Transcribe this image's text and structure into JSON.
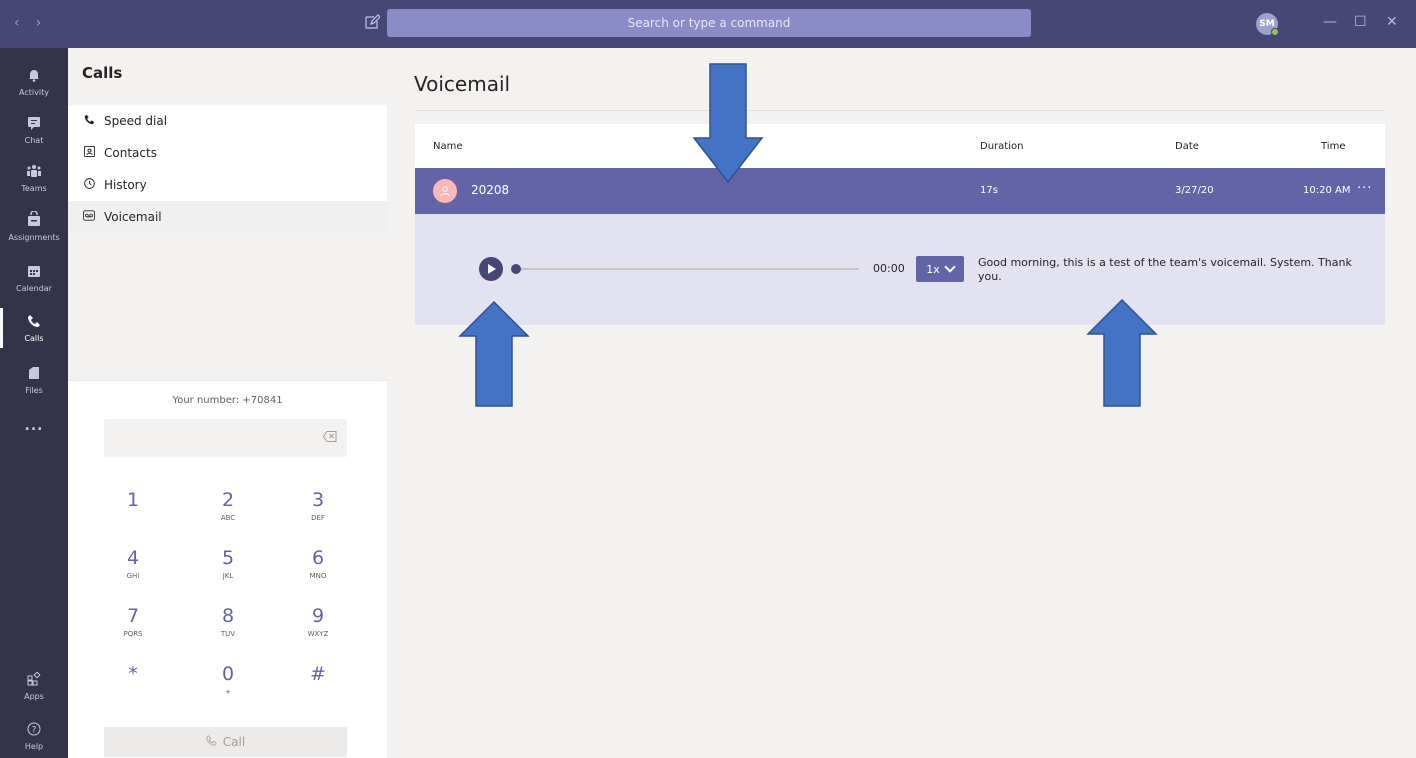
{
  "titlebar": {
    "search_placeholder": "Search or type a command",
    "avatar_initials": "SM",
    "nav_back": "‹",
    "nav_forward": "›",
    "minimize": "—",
    "maximize": "☐",
    "close": "✕"
  },
  "rail": {
    "items": [
      {
        "label": "Activity",
        "icon": "bell-icon"
      },
      {
        "label": "Chat",
        "icon": "chat-icon"
      },
      {
        "label": "Teams",
        "icon": "teams-icon"
      },
      {
        "label": "Assignments",
        "icon": "assignments-icon"
      },
      {
        "label": "Calendar",
        "icon": "calendar-icon"
      },
      {
        "label": "Calls",
        "icon": "phone-icon"
      },
      {
        "label": "Files",
        "icon": "file-icon"
      }
    ],
    "more": "...",
    "apps": "Apps",
    "help": "Help"
  },
  "calls": {
    "title": "Calls",
    "items": [
      {
        "label": "Speed dial",
        "icon": "phone-icon"
      },
      {
        "label": "Contacts",
        "icon": "contacts-icon"
      },
      {
        "label": "History",
        "icon": "clock-icon"
      },
      {
        "label": "Voicemail",
        "icon": "voicemail-icon"
      }
    ],
    "your_number": "Your number: +70841",
    "call_label": "Call",
    "keys": [
      {
        "digit": "1",
        "letters": ""
      },
      {
        "digit": "2",
        "letters": "ABC"
      },
      {
        "digit": "3",
        "letters": "DEF"
      },
      {
        "digit": "4",
        "letters": "GHI"
      },
      {
        "digit": "5",
        "letters": "JKL"
      },
      {
        "digit": "6",
        "letters": "MNO"
      },
      {
        "digit": "7",
        "letters": "PQRS"
      },
      {
        "digit": "8",
        "letters": "TUV"
      },
      {
        "digit": "9",
        "letters": "WXYZ"
      },
      {
        "digit": "*",
        "letters": ""
      },
      {
        "digit": "0",
        "letters": "+"
      },
      {
        "digit": "#",
        "letters": ""
      }
    ]
  },
  "voicemail": {
    "title": "Voicemail",
    "columns": {
      "name": "Name",
      "duration": "Duration",
      "date": "Date",
      "time": "Time"
    },
    "row": {
      "name": "20208",
      "duration": "17s",
      "date": "3/27/20",
      "time": "10:20 AM",
      "more": "···"
    },
    "player": {
      "elapsed": "00:00",
      "speed": "1x"
    },
    "transcript": "Good morning, this is a test of the team's voicemail. System. Thank you."
  },
  "colors": {
    "accent": "#6264a7",
    "titlebar": "#464775",
    "rail": "#33344a",
    "arrow": "#4472c4"
  }
}
